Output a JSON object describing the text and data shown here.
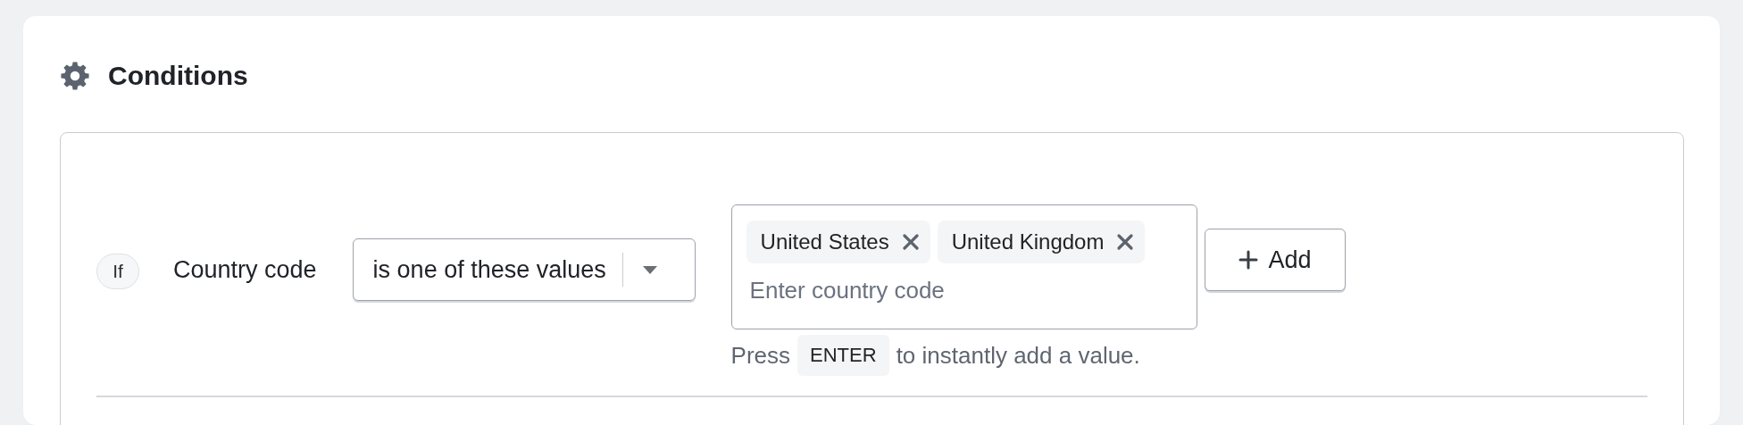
{
  "card": {
    "title": "Conditions"
  },
  "condition": {
    "prefix": "If",
    "field": "Country code",
    "operator": "is one of these values",
    "tags": [
      {
        "label": "United States"
      },
      {
        "label": "United Kingdom"
      }
    ],
    "placeholder": "Enter country code",
    "hint": {
      "before": "Press",
      "key": "ENTER",
      "after": "to instantly add a value."
    },
    "add_button": "Add"
  }
}
